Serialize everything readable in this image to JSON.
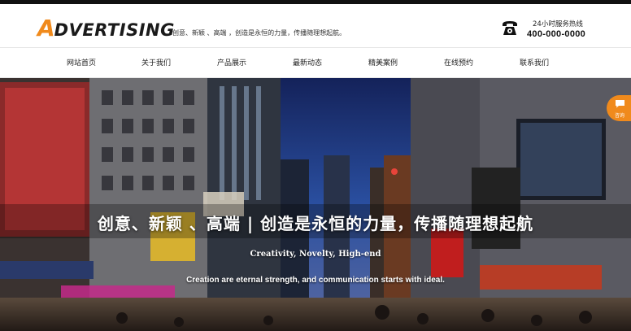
{
  "header": {
    "logo_first": "A",
    "logo_rest": "DVERTISING",
    "slogan": "创意、新颖 、高端 ，创造是永恒的力量，传播随理想起航。",
    "hotline_label": "24小时服务热线",
    "hotline_number": "400-000-0000"
  },
  "nav": {
    "items": [
      {
        "label": "网站首页"
      },
      {
        "label": "关于我们"
      },
      {
        "label": "产品展示"
      },
      {
        "label": "最新动态"
      },
      {
        "label": "精美案例"
      },
      {
        "label": "在线预约"
      },
      {
        "label": "联系我们"
      }
    ]
  },
  "banner": {
    "headline": "创意、新颖 、高端 | 创造是永恒的力量，传播随理想起航",
    "subtitle_en": "Creativity, Novelty, High-end",
    "tagline_en": "Creation are eternal strength, and communication starts with ideal."
  },
  "consult": {
    "label": "咨询"
  },
  "colors": {
    "accent": "#f08a1c",
    "top_bar": "#111111"
  }
}
